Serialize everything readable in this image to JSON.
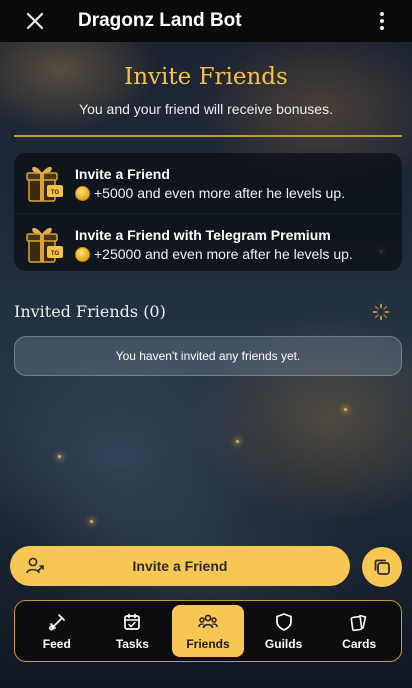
{
  "app": {
    "title": "Dragonz Land Bot"
  },
  "page": {
    "heading": "Invite Friends",
    "subheading": "You and your friend will receive bonuses."
  },
  "invite_options": [
    {
      "title": "Invite a Friend",
      "bonus": "+5000",
      "description": "+5000 and even more after he levels up."
    },
    {
      "title": "Invite a Friend with Telegram Premium",
      "bonus": "+25000",
      "description": "+25000 and even more after he levels up."
    }
  ],
  "invited": {
    "label": "Invited Friends (0)",
    "count": 0,
    "empty_message": "You haven't invited any friends yet."
  },
  "actions": {
    "invite_button_label": "Invite a Friend"
  },
  "nav": {
    "items": [
      {
        "label": "Feed",
        "icon": "feed-icon",
        "active": false
      },
      {
        "label": "Tasks",
        "icon": "tasks-icon",
        "active": false
      },
      {
        "label": "Friends",
        "icon": "friends-icon",
        "active": true
      },
      {
        "label": "Guilds",
        "icon": "shield-icon",
        "active": false
      },
      {
        "label": "Cards",
        "icon": "cards-icon",
        "active": false
      }
    ]
  },
  "colors": {
    "accent": "#f8c652",
    "heading": "#f7c24b",
    "divider": "#c99b33",
    "topbar": "#0a0a0a"
  }
}
